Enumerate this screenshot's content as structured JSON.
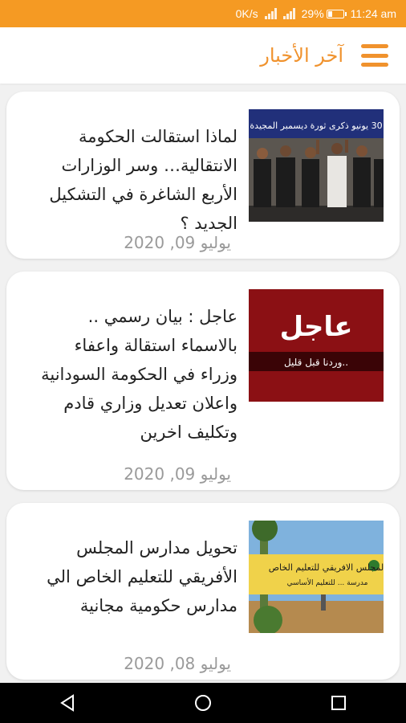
{
  "status_bar": {
    "net_speed": "0K/s",
    "battery_percent": "29%",
    "time": "11:24 am",
    "battery_level": 0.29
  },
  "app_bar": {
    "title": "آخر الأخبار"
  },
  "articles": [
    {
      "headline": "لماذا استقالت الحكومة الانتقالية… وسر الوزارات الأربع الشاغرة في التشكيل الجديد ؟",
      "date": "يوليو 09, 2020",
      "thumb_banner": "30 يونيو ذكرى ثورة ديسمبر المجيدة"
    },
    {
      "headline": "عاجل : بيان رسمي .. بالاسماء استقالة واعفاء وزراء في الحكومة السودانية واعلان تعديل وزاري قادم وتكليف اخرين",
      "date": "يوليو 09, 2020",
      "thumb_big": "عاجل",
      "thumb_small": "وردنا قبل قليل.."
    },
    {
      "headline": "تحويل مدارس المجلس الأفريقي للتعليم الخاص الي مدارس حكومية مجانية",
      "date": "يوليو 08, 2020",
      "thumb_sign_top": "المجلس الافريقي للتعليم الخاص",
      "thumb_sign_bottom": "مدرسة ... للتعليم الأساسي"
    }
  ],
  "colors": {
    "accent": "#f0922d",
    "status_bar": "#f59a23",
    "breaking_red": "#8b1014"
  }
}
